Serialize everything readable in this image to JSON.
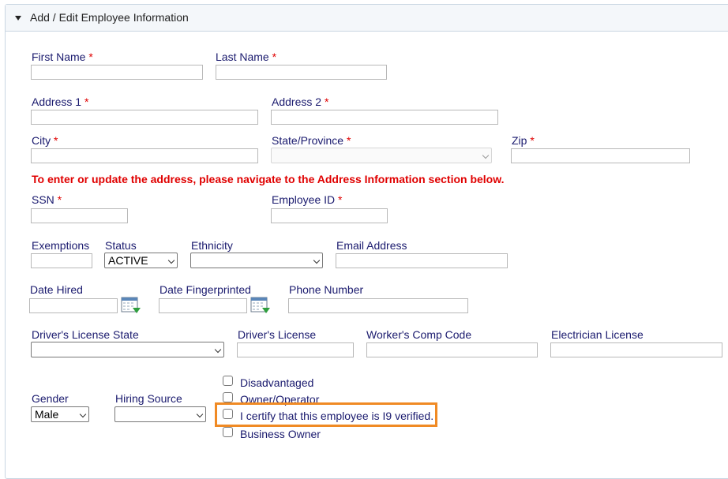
{
  "panel": {
    "title": "Add / Edit Employee Information"
  },
  "fields": {
    "first_name": "First Name",
    "last_name": "Last Name",
    "address1": "Address 1",
    "address2": "Address 2",
    "city": "City",
    "state": "State/Province",
    "zip": "Zip",
    "ssn": "SSN",
    "employee_id": "Employee ID",
    "exemptions": "Exemptions",
    "status": "Status",
    "ethnicity": "Ethnicity",
    "email": "Email Address",
    "date_hired": "Date Hired",
    "date_fingerprinted": "Date Fingerprinted",
    "phone": "Phone Number",
    "dl_state": "Driver's License State",
    "dl": "Driver's License",
    "wc_code": "Worker's Comp Code",
    "electrician": "Electrician License",
    "gender": "Gender",
    "hiring_source": "Hiring Source"
  },
  "required_marker": "*",
  "notice": "To enter or update the address, please navigate to the Address Information section below.",
  "values": {
    "status": "ACTIVE",
    "gender": "Male",
    "ethnicity": "",
    "dl_state": "",
    "hiring_source": "",
    "state": ""
  },
  "checkboxes": {
    "disadvantaged": "Disadvantaged",
    "owner_operator": "Owner/Operator",
    "i9": "I certify that this employee is I9 verified.",
    "business_owner": "Business Owner"
  },
  "icons": {
    "calendar": "calendar-icon",
    "caret": "caret-down-icon"
  },
  "colors": {
    "required": "#e00000",
    "label": "#1a1a6e",
    "highlight": "#f08a24"
  }
}
